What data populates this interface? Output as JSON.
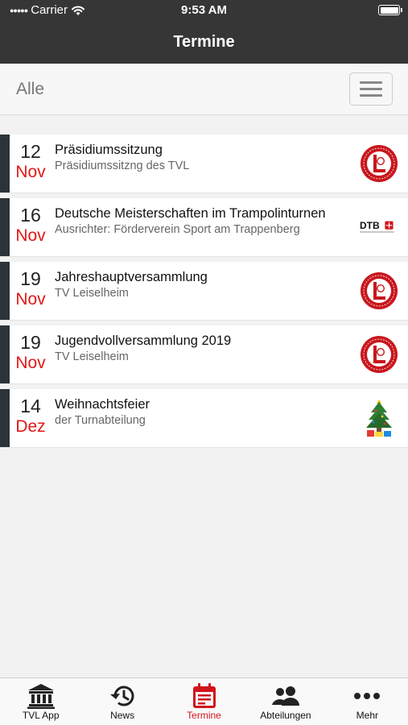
{
  "status_bar": {
    "carrier": "Carrier",
    "time": "9:53 AM"
  },
  "nav": {
    "title": "Termine"
  },
  "filter": {
    "label": "Alle"
  },
  "events": [
    {
      "day": "12",
      "month": "Nov",
      "title": "Präsidiumssitzung",
      "subtitle": "Präsidiumssitzng des TVL",
      "logo": "tvl-club-logo"
    },
    {
      "day": "16",
      "month": "Nov",
      "title": "Deutsche Meisterschaften im Trampolinturnen",
      "subtitle": "Ausrichter: Förderverein Sport am Trappenberg",
      "logo": "dtb-logo",
      "logo_text": "DTB"
    },
    {
      "day": "19",
      "month": "Nov",
      "title": "Jahreshauptversammlung",
      "subtitle": "TV Leiselheim",
      "logo": "tvl-club-logo"
    },
    {
      "day": "19",
      "month": "Nov",
      "title": "Jugendvollversammlung 2019",
      "subtitle": "TV Leiselheim",
      "logo": "tvl-club-logo"
    },
    {
      "day": "14",
      "month": "Dez",
      "title": "Weihnachtsfeier",
      "subtitle": "der Turnabteilung",
      "logo": "christmas-tree-icon"
    }
  ],
  "tabs": [
    {
      "label": "TVL App",
      "icon": "bank-icon"
    },
    {
      "label": "News",
      "icon": "history-icon"
    },
    {
      "label": "Termine",
      "icon": "calendar-icon",
      "active": true
    },
    {
      "label": "Abteilungen",
      "icon": "users-icon"
    },
    {
      "label": "Mehr",
      "icon": "more-dots-icon"
    }
  ],
  "colors": {
    "header_bg": "#363636",
    "accent_red": "#d0141c",
    "month_red": "#e01818",
    "stripe": "#2b3438"
  }
}
